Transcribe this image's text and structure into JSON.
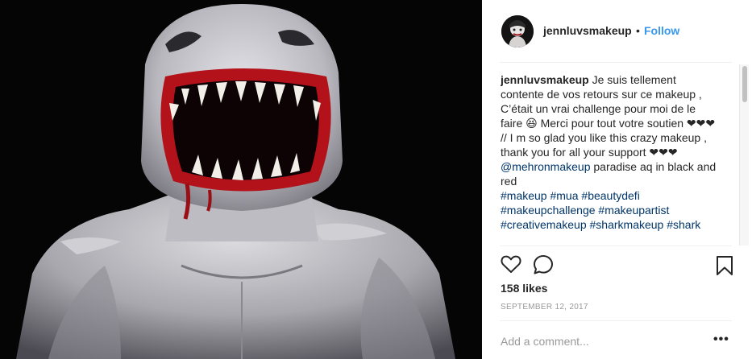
{
  "post": {
    "username": "jennluvsmakeup",
    "separator": "•",
    "follow_label": "Follow",
    "avatar_icon": "profile-avatar",
    "photo_icon": "shark-makeup-photo"
  },
  "caption": {
    "username": "jennluvsmakeup",
    "line1": " Je suis tellement contente de vos retours sur ce makeup , C’était un vrai challenge pour moi de le faire 😆 Merci pour tout votre soutien ❤❤❤",
    "line2": "// I m so glad you like this crazy makeup , thank you for all your support ❤❤❤",
    "mention": "@mehronmakeup",
    "line3": " paradise aq in black and red",
    "hashtags": [
      "#makeup",
      "#mua",
      "#beautydefi",
      "#makeupchallenge",
      "#makeupartist",
      "#creativemakeup",
      "#sharkmakeup",
      "#shark"
    ]
  },
  "actions": {
    "like_icon": "heart-icon",
    "comment_icon": "comment-icon",
    "save_icon": "bookmark-icon"
  },
  "likes_text": "158 likes",
  "date_text": "SEPTEMBER 12, 2017",
  "comment_box": {
    "placeholder": "Add a comment...",
    "more_label": "•••"
  },
  "colors": {
    "link": "#003569",
    "follow": "#3897f0",
    "text": "#262626",
    "muted": "#999999"
  }
}
